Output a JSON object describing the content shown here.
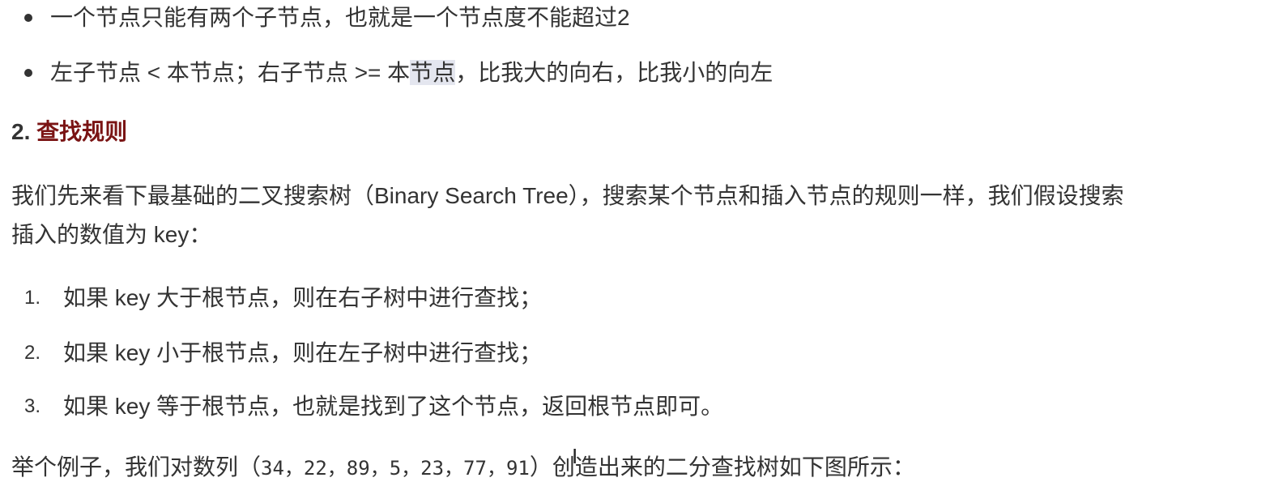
{
  "bullets": [
    "一个节点只能有两个子节点，也就是一个节点度不能超过2",
    {
      "before": "左子节点 < 本节点；右子节点 >= 本",
      "highlight": "节点",
      "after": "，比我大的向右，比我小的向左"
    }
  ],
  "heading": {
    "number": "2.",
    "title": "查找规则"
  },
  "paragraph": {
    "line1": "我们先来看下最基础的二叉搜索树（Binary Search Tree），搜索某个节点和插入节点的规则一样，我们假设搜索",
    "line2": "插入的数值为 key："
  },
  "ordered_list": [
    {
      "num": "1.",
      "text": "如果 key 大于根节点，则在右子树中进行查找；"
    },
    {
      "num": "2.",
      "text": "如果 key 小于根节点，则在左子树中进行查找；"
    },
    {
      "num": "3.",
      "text": "如果 key 等于根节点，也就是找到了这个节点，返回根节点即可。"
    }
  ],
  "example": {
    "before": "举个例子，我们对数列（",
    "sequence": "34，22，89，5，23，77，91",
    "after": "）创造出来的二分查找树如下图所示："
  }
}
